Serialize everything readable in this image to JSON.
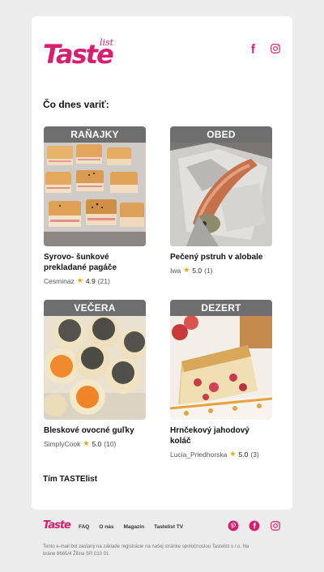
{
  "brand": {
    "logo_text": "Taste",
    "logo_sub": "list",
    "accent": "#d61f6f"
  },
  "header": {
    "social": [
      "facebook-icon",
      "instagram-icon"
    ]
  },
  "heading": "Čo dnes variť:",
  "recipes": [
    {
      "category": "RAŇAJKY",
      "title": "Syrovo- šunkové prekladané pagáče",
      "author": "Cesminaz",
      "rating": "4.9",
      "count": "(21)"
    },
    {
      "category": "OBED",
      "title": "Pečený pstruh v alobale",
      "author": "Iwa",
      "rating": "5.0",
      "count": "(1)"
    },
    {
      "category": "VEČERA",
      "title": "Bleskové ovocné guľky",
      "author": "SimplyCook",
      "rating": "5.0",
      "count": "(10)"
    },
    {
      "category": "DEZERT",
      "title": "Hrnčekový jahodový koláč",
      "author": "Lucia_Priedhorska",
      "rating": "5.0",
      "count": "(3)"
    }
  ],
  "signoff": "Tím TASTElist",
  "footer": {
    "logo": "Taste",
    "links": [
      "FAQ",
      "O nás",
      "Magazín",
      "Tastelist TV"
    ],
    "social": [
      "pinterest-icon",
      "facebook-icon",
      "instagram-icon"
    ],
    "legal": "Tento e-mail bol zaslaný na základe registrácie na našej stránke spoločnostou Tastelist s.r.o. Na bráne 8665/4 Žilina SR 010 01."
  }
}
